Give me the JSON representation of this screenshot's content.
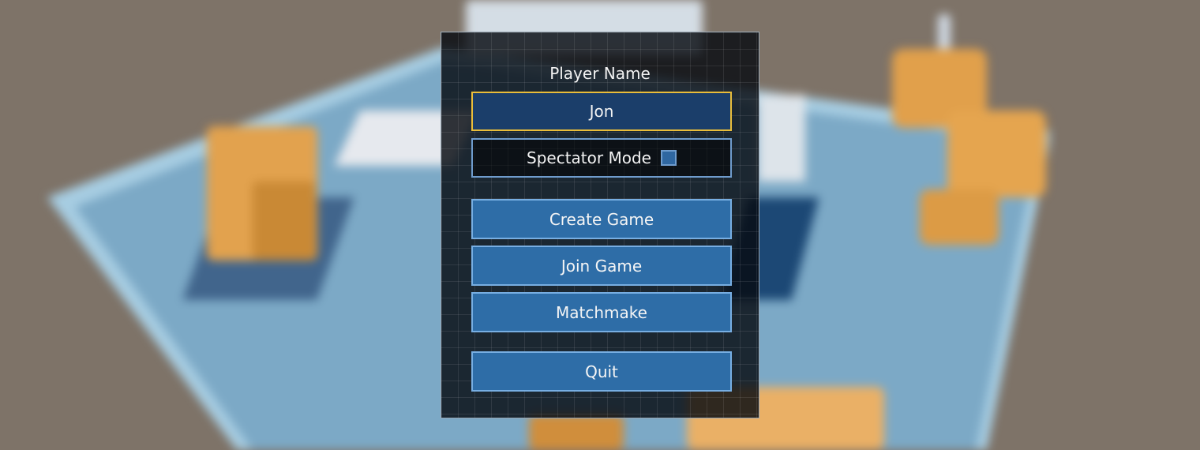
{
  "menu": {
    "player_name_label": "Player Name",
    "player_name_value": "Jon",
    "spectator_label": "Spectator Mode",
    "spectator_checked": false,
    "buttons": {
      "create_game": "Create Game",
      "join_game": "Join Game",
      "matchmake": "Matchmake",
      "quit": "Quit"
    }
  },
  "colors": {
    "button_fill": "#2e6da7",
    "input_focus_border": "#e9bd3a",
    "input_fill": "#1b3e6a",
    "cube_orange": "#e2a24e",
    "floor_blue": "#7ca9c6"
  }
}
